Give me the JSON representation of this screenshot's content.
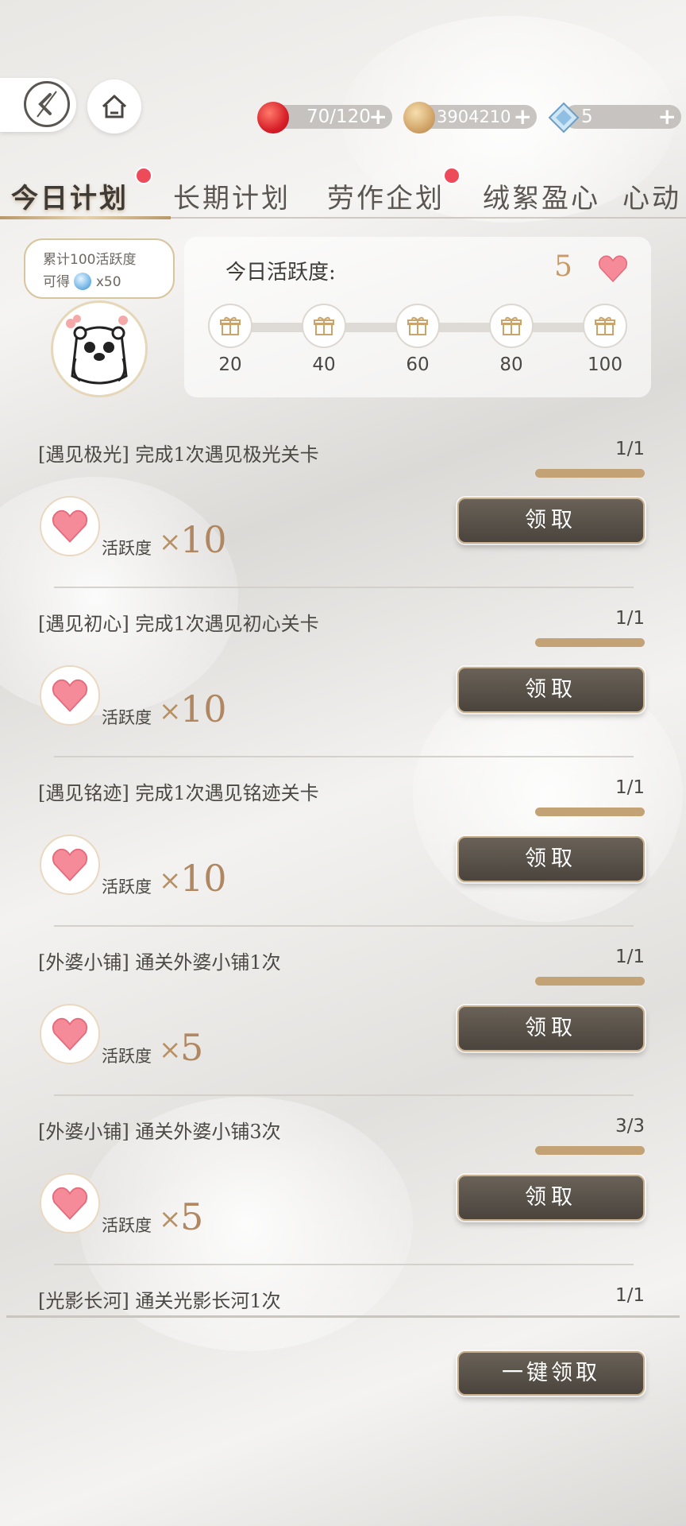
{
  "header": {
    "resources": [
      {
        "icon": "apple-icon",
        "value": "70/120",
        "plus": "+"
      },
      {
        "icon": "gold-coin-icon",
        "value": "3904210",
        "plus": "+"
      },
      {
        "icon": "diamond-icon",
        "value": "5",
        "plus": "+"
      }
    ]
  },
  "tabs": [
    {
      "label": "今日计划",
      "active": true,
      "badge": true
    },
    {
      "label": "长期计划",
      "active": false,
      "badge": false
    },
    {
      "label": "劳作企划",
      "active": false,
      "badge": true
    },
    {
      "label": "绒絮盈心",
      "active": false,
      "badge": false
    },
    {
      "label": "心动",
      "active": false,
      "badge": false
    }
  ],
  "activity": {
    "bubble_line1": "累计100活跃度",
    "bubble_prefix": "可得",
    "bubble_reward": "x50",
    "label": "今日活跃度:",
    "value": "5",
    "milestones": [
      "20",
      "40",
      "60",
      "80",
      "100"
    ]
  },
  "tasks": [
    {
      "title": "[遇见极光] 完成1次遇见极光关卡",
      "progress": "1/1",
      "progress_fraction": 1.0,
      "reward_label": "活跃度",
      "reward_x": "×",
      "reward_amount": "10",
      "button": "领取"
    },
    {
      "title": "[遇见初心] 完成1次遇见初心关卡",
      "progress": "1/1",
      "progress_fraction": 1.0,
      "reward_label": "活跃度",
      "reward_x": "×",
      "reward_amount": "10",
      "button": "领取"
    },
    {
      "title": "[遇见铭迹] 完成1次遇见铭迹关卡",
      "progress": "1/1",
      "progress_fraction": 1.0,
      "reward_label": "活跃度",
      "reward_x": "×",
      "reward_amount": "10",
      "button": "领取"
    },
    {
      "title": "[外婆小铺] 通关外婆小铺1次",
      "progress": "1/1",
      "progress_fraction": 1.0,
      "reward_label": "活跃度",
      "reward_x": "×",
      "reward_amount": "5",
      "button": "领取"
    },
    {
      "title": "[外婆小铺] 通关外婆小铺3次",
      "progress": "3/3",
      "progress_fraction": 1.0,
      "reward_label": "活跃度",
      "reward_x": "×",
      "reward_amount": "5",
      "button": "领取"
    },
    {
      "title": "[光影长河] 通关光影长河1次",
      "progress": "1/1",
      "progress_fraction": 1.0
    }
  ],
  "footer": {
    "claim_all": "一键领取"
  },
  "colors": {
    "accent_gold": "#c3a275",
    "button_dark": "#4a443d",
    "badge_red": "#ee4b5a",
    "heart_pink": "#f27c8a"
  }
}
